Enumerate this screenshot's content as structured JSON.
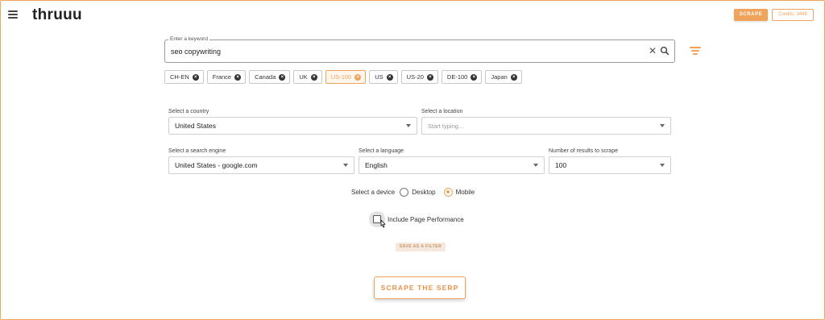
{
  "app": {
    "logo": "thruuu"
  },
  "header": {
    "scrape_label": "SCRAPE",
    "credits_label": "Credits: 3449"
  },
  "keyword": {
    "label": "Enter a keyword",
    "value": "seo copywriting"
  },
  "chips": [
    {
      "label": "CH-EN",
      "active": false
    },
    {
      "label": "France",
      "active": false
    },
    {
      "label": "Canada",
      "active": false
    },
    {
      "label": "UK",
      "active": false
    },
    {
      "label": "US-100",
      "active": true
    },
    {
      "label": "US",
      "active": false
    },
    {
      "label": "US-20",
      "active": false
    },
    {
      "label": "DE-100",
      "active": false
    },
    {
      "label": "Japan",
      "active": false
    }
  ],
  "form": {
    "country": {
      "label": "Select a country",
      "value": "United States"
    },
    "location": {
      "label": "Select a location",
      "placeholder": "Start typing..."
    },
    "engine": {
      "label": "Select a search engine",
      "value": "United States - google.com"
    },
    "language": {
      "label": "Select a language",
      "value": "English"
    },
    "results": {
      "label": "Number of results to scrape",
      "value": "100"
    },
    "device": {
      "label": "Select a device",
      "options": [
        "Desktop",
        "Mobile"
      ],
      "selected": "Mobile"
    },
    "performance": {
      "label": "Include Page Performance",
      "checked": false
    }
  },
  "actions": {
    "save_filter": "SAVE AS A FILTER",
    "scrape_serp": "SCRAPE THE SERP"
  },
  "colors": {
    "accent": "#f0a35a"
  }
}
